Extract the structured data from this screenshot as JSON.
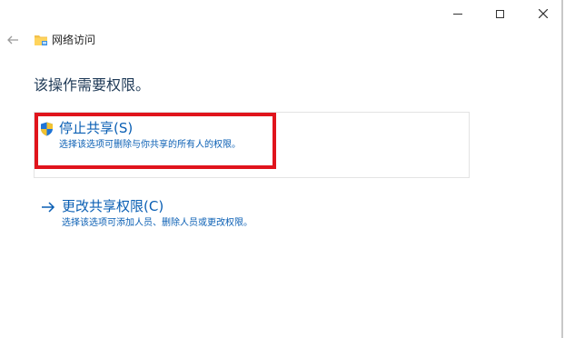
{
  "window": {
    "title": "网络访问"
  },
  "caption": {
    "minimize": "minimize-icon",
    "maximize": "maximize-icon",
    "close": "close-icon"
  },
  "heading": "该操作需要权限。",
  "options": [
    {
      "title": "停止共享(S)",
      "description": "选择该选项可删除与你共享的所有人的权限。",
      "icon": "shield-icon"
    },
    {
      "title": "更改共享权限(C)",
      "description": "选择该选项可添加人员、删除人员或更改权限。",
      "icon": "arrow-right-icon"
    }
  ],
  "colors": {
    "link": "#0a5fb4",
    "highlight": "#e0141c",
    "heading": "#1f3a57"
  }
}
